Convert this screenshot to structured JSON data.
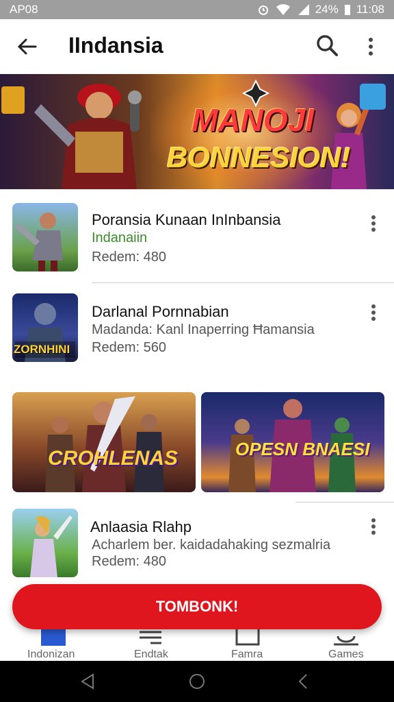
{
  "status": {
    "left": "AP08",
    "battery": "24%",
    "time": "11:08"
  },
  "appbar": {
    "title": "IIndansia"
  },
  "banner": {
    "line1": "MANOJI",
    "line2": "BONNESION!"
  },
  "items": [
    {
      "title": "Poransia Kunaan InInbansia",
      "subtitle": "Indanaiin",
      "meta": "Redem: 480",
      "subtitle_color": "#3a8a2a"
    },
    {
      "title": "Darlanal Pornnabian",
      "subtitle": "Madanda: Kanl Inaperring Ħamansia",
      "meta": "Redem: 560",
      "thumb_label": "ZORNHINI",
      "subtitle_color": "#555555"
    },
    {
      "title": "Anlaasia Rlahp",
      "subtitle": "Acharlem ber. kaidadahaking sezmalria",
      "meta": "Redem: 480",
      "subtitle_color": "#555555"
    }
  ],
  "tiles": [
    {
      "label": "CROHLENAS"
    },
    {
      "label": "OPESN BNAESI"
    }
  ],
  "cta": {
    "label": "TOMBONK!"
  },
  "bottom_nav": [
    {
      "label": "Indonizan",
      "icon": "home-icon"
    },
    {
      "label": "Endtak",
      "icon": "list-icon"
    },
    {
      "label": "Famra",
      "icon": "bookmark-icon"
    },
    {
      "label": "Games",
      "icon": "profile-icon"
    }
  ],
  "colors": {
    "accent": "#e0161f",
    "status_bar": "#9e9e9e",
    "subtitle_green": "#3a8a2a"
  }
}
